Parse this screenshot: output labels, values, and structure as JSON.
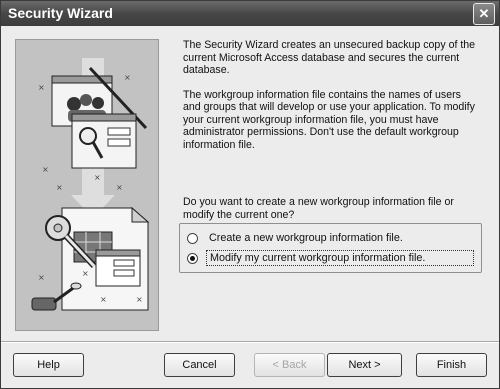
{
  "window": {
    "title": "Security Wizard"
  },
  "title_bar": {
    "close_glyph": "✕"
  },
  "description": {
    "p1": "The Security Wizard creates an unsecured backup copy of the current Microsoft Access database and secures the current database.",
    "p2": "The workgroup information file contains the names of users and groups that will develop or use your application. To modify your current workgroup information file, you must have administrator permissions. Don't use the default workgroup information file."
  },
  "question": "Do you want to create a new workgroup information file or modify the current one?",
  "options": [
    {
      "label": "Create a new workgroup information file.",
      "selected": false
    },
    {
      "label": "Modify my current workgroup information file.",
      "selected": true
    }
  ],
  "buttons": {
    "help": "Help",
    "cancel": "Cancel",
    "back": "< Back",
    "next": "Next >",
    "finish": "Finish"
  },
  "illustration": {
    "icons": [
      "user-group-icon",
      "key-icon",
      "database-document-icon",
      "plug-icon"
    ]
  }
}
